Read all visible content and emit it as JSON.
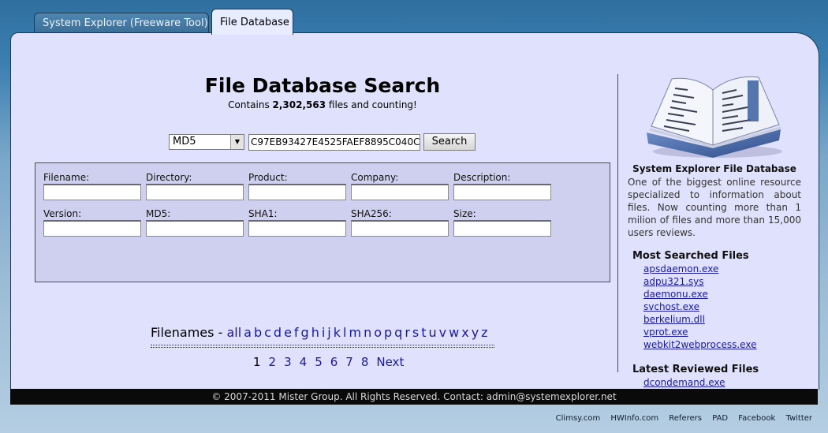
{
  "tabs": [
    {
      "label": "System Explorer (Freeware Tool)"
    },
    {
      "label": "File Database"
    }
  ],
  "search": {
    "title": "File Database Search",
    "subtitle_prefix": "Contains ",
    "file_count": "2,302,563",
    "subtitle_suffix": " files and counting!",
    "hash_type": "MD5",
    "hash_value": "C97EB93427E4525FAEF8895C040C",
    "button_label": "Search"
  },
  "fields": [
    {
      "label": "Filename:"
    },
    {
      "label": "Directory:"
    },
    {
      "label": "Product:"
    },
    {
      "label": "Company:"
    },
    {
      "label": "Description:"
    },
    {
      "label": "Version:"
    },
    {
      "label": "MD5:"
    },
    {
      "label": "SHA1:"
    },
    {
      "label": "SHA256:"
    },
    {
      "label": "Size:"
    }
  ],
  "filenames": {
    "label": "Filenames",
    "separator": " - ",
    "links": [
      "all",
      "a",
      "b",
      "c",
      "d",
      "e",
      "f",
      "g",
      "h",
      "i",
      "j",
      "k",
      "l",
      "m",
      "n",
      "o",
      "p",
      "q",
      "r",
      "s",
      "t",
      "u",
      "v",
      "w",
      "x",
      "y",
      "z"
    ]
  },
  "pager": {
    "current": "1",
    "pages": [
      "2",
      "3",
      "4",
      "5",
      "6",
      "7",
      "8"
    ],
    "next": "Next"
  },
  "sidebar": {
    "title": "System Explorer File Database",
    "description": "One of the biggest online resource specialized to information about files. Now counting more than 1 milion of files and more than 15,000 users reviews.",
    "most_searched_heading": "Most Searched Files",
    "most_searched": [
      "apsdaemon.exe",
      "adpu321.sys",
      "daemonu.exe",
      "svchost.exe",
      "berkelium.dll",
      "vprot.exe",
      "webkit2webprocess.exe"
    ],
    "latest_heading": "Latest Reviewed Files",
    "latest": [
      "dcondemand.exe"
    ]
  },
  "footer": {
    "copyright": "© 2007-2011 Mister Group. All Rights Reserved. Contact: admin@systemexplorer.net"
  },
  "bottom_links": [
    "Climsy.com",
    "HWInfo.com",
    "Referers",
    "PAD",
    "Facebook",
    "Twitter"
  ]
}
